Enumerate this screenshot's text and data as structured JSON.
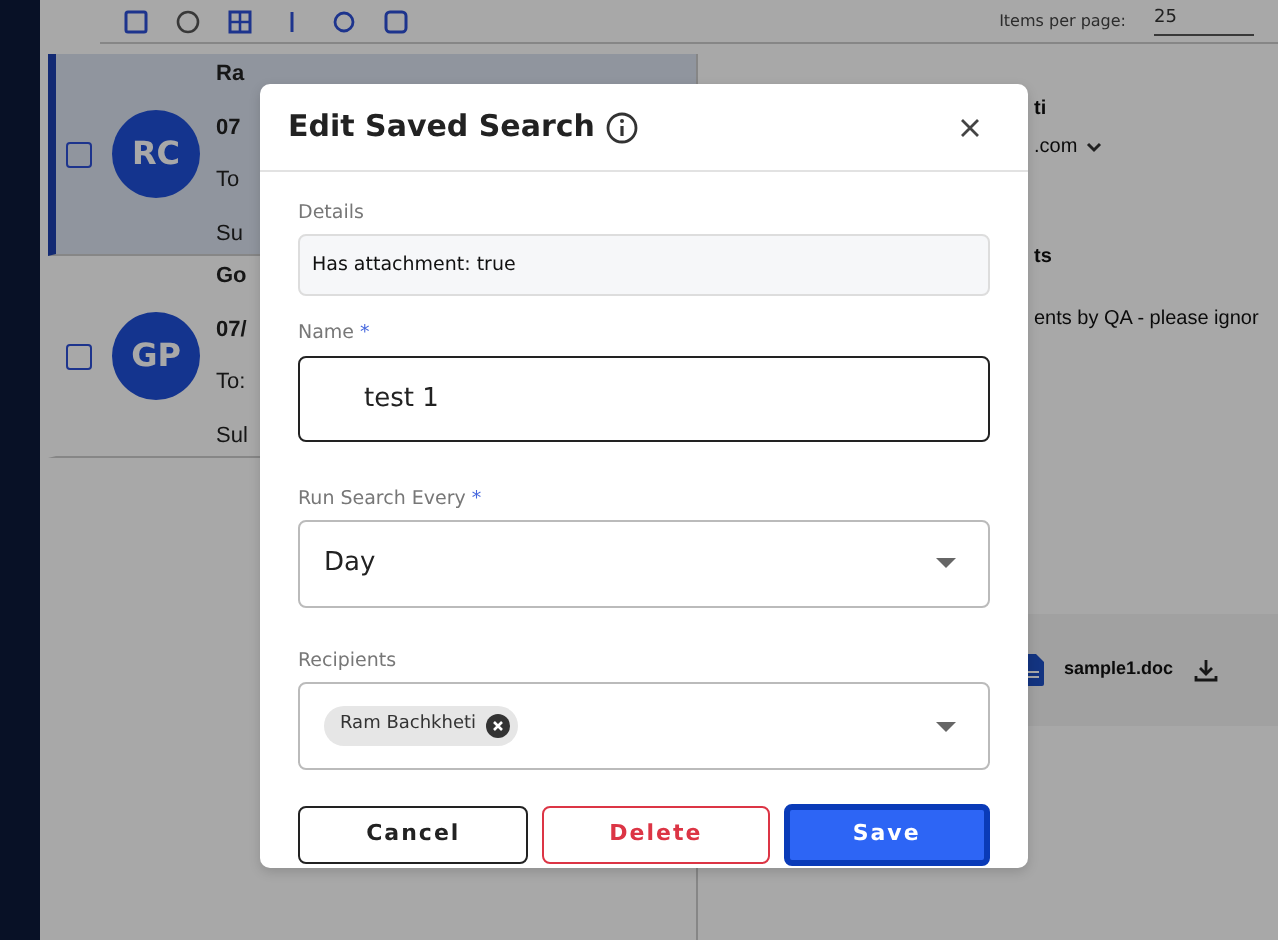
{
  "background": {
    "toolbar": {
      "items_per_page_label": "Items per page:",
      "items_per_page_value": "25"
    },
    "messages": [
      {
        "initials": "RC",
        "sender": "Ra",
        "date": "07",
        "to": "To",
        "subject": "Su",
        "selected": true
      },
      {
        "initials": "GP",
        "sender": "Go",
        "date": "07/",
        "to": "To:",
        "subject": "Sul",
        "selected": false
      }
    ],
    "detail": {
      "sender": "ti",
      "address": ".com",
      "section_title": "ts",
      "body": "ents by QA - please ignor",
      "attachment": {
        "name": "sample1.doc"
      }
    }
  },
  "dialog": {
    "title": "Edit Saved Search",
    "fields": [
      {
        "kind": "readonly",
        "label": "Details",
        "value": "Has attachment: true"
      },
      {
        "kind": "text",
        "label": "Name",
        "required_mark": "*",
        "value": "test 1",
        "focused": true
      },
      {
        "kind": "select",
        "label": "Run Search Every",
        "required_mark": "*",
        "value": "Day"
      },
      {
        "kind": "chips",
        "label": "Recipients",
        "chips": [
          "Ram Bachkheti"
        ]
      }
    ],
    "buttons": [
      {
        "kind": "secondary",
        "label": "Cancel",
        "focused": false
      },
      {
        "kind": "danger",
        "label": "Delete",
        "focused": false
      },
      {
        "kind": "primary",
        "label": "Save",
        "focused": true
      }
    ]
  }
}
